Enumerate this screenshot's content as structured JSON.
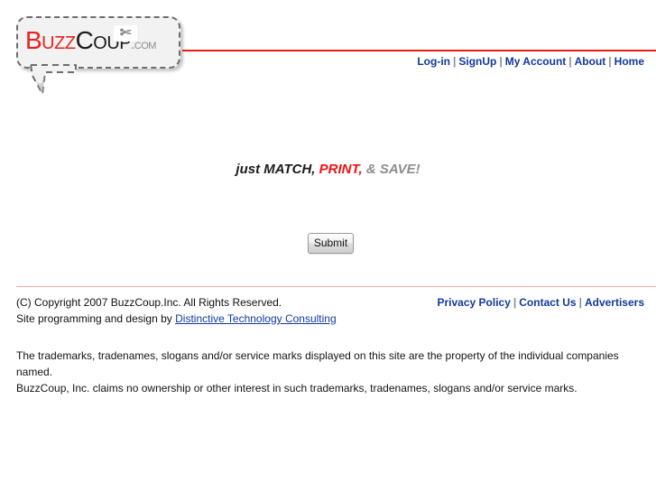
{
  "header": {
    "logo": {
      "scissors_icon": "scissors-icon",
      "part_buzz": "Buzz",
      "part_coup": "Coup",
      "part_dotcom": ".com",
      "color_buzz": "#e8231f",
      "color_coup": "#1a1a1a",
      "color_dotcom": "#8c8c8c"
    },
    "rule_color": "#ee1c12",
    "nav": {
      "separator": "|",
      "items": [
        {
          "label": "Log-in"
        },
        {
          "label": "SignUp"
        },
        {
          "label": "My Account"
        },
        {
          "label": "About"
        },
        {
          "label": "Home"
        }
      ]
    }
  },
  "main": {
    "tagline": {
      "match": "just MATCH,",
      "print": "PRINT,",
      "save": "& SAVE!",
      "color_print": "#ee1111",
      "color_save": "#8d8d8d"
    },
    "submit_label": "Submit"
  },
  "footer": {
    "rule_color": "#f0aaa6",
    "copyright": "(C) Copyright 2007 BuzzCoup.Inc. All Rights Reserved.",
    "credit_prefix": "Site programming and design by ",
    "credit_link": "Distinctive Technology Consulting",
    "links": {
      "separator": "|",
      "items": [
        {
          "label": "Privacy Policy"
        },
        {
          "label": "Contact Us"
        },
        {
          "label": "Advertisers"
        }
      ]
    },
    "disclaimer_line1": "The trademarks, tradenames, slogans and/or service marks displayed on this site are the property of the individual companies named.",
    "disclaimer_line2": "BuzzCoup, Inc. claims no ownership or other interest in such trademarks, tradenames, slogans and/or service marks."
  }
}
